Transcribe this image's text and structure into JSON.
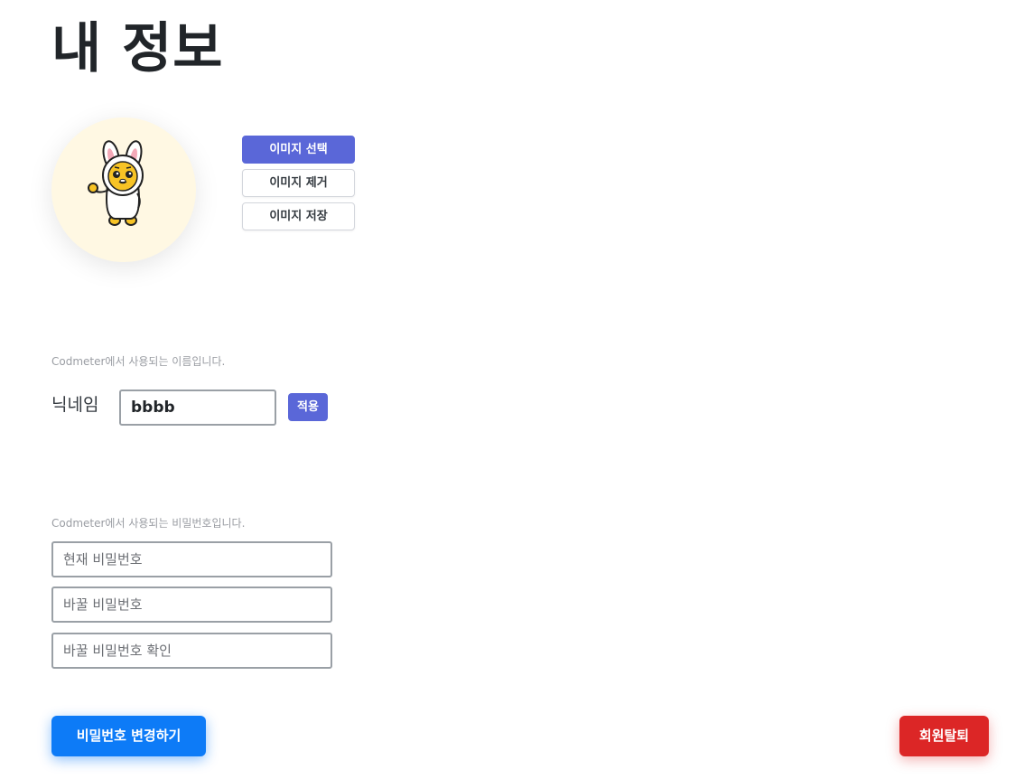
{
  "page": {
    "title": "내 정보"
  },
  "profile_image": {
    "icon": "bunny-costume-character",
    "background_color": "#fff8e3",
    "buttons": {
      "select": "이미지 선택",
      "remove": "이미지 제거",
      "save": "이미지 저장"
    }
  },
  "nickname": {
    "helper": "Codmeter에서 사용되는 이름입니다.",
    "label": "닉네임",
    "value": "bbbb",
    "apply": "적용"
  },
  "password": {
    "helper": "Codmeter에서 사용되는 비밀번호입니다.",
    "current_placeholder": "현재 비밀번호",
    "new_placeholder": "바꿀 비밀번호",
    "confirm_placeholder": "바꿀 비밀번호 확인",
    "change_button": "비밀번호 변경하기"
  },
  "account": {
    "withdraw_button": "회원탈퇴"
  },
  "colors": {
    "primary": "#5a67d8",
    "change_button": "#0d7bf7",
    "danger": "#dc2626"
  }
}
